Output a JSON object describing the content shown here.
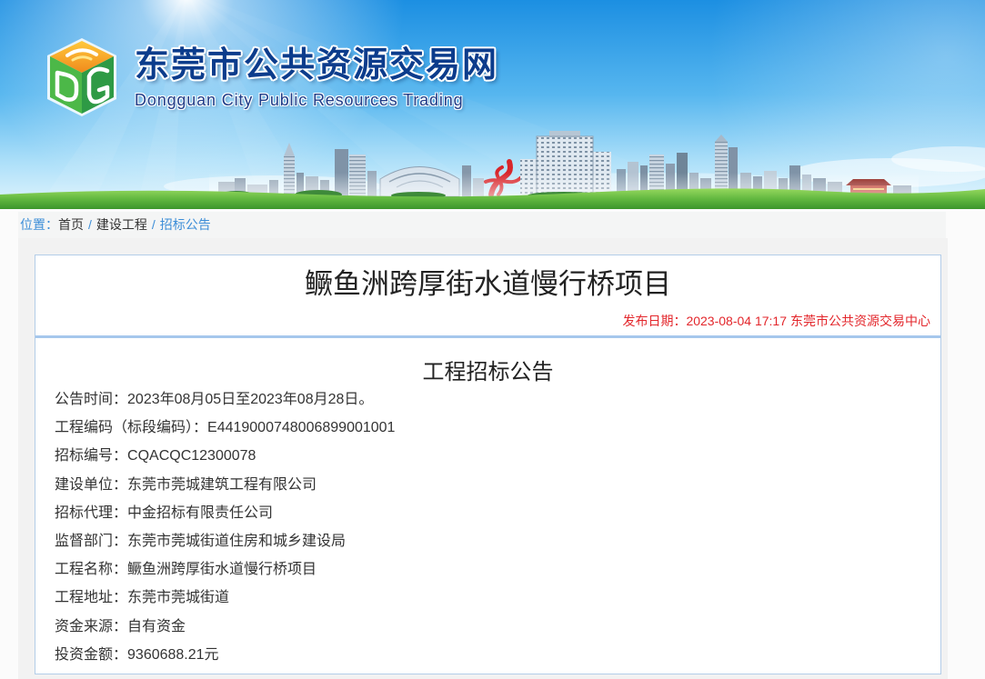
{
  "header": {
    "title_cn": "东莞市公共资源交易网",
    "title_en": "Dongguan City Public Resources Trading"
  },
  "breadcrumb": {
    "label": "位置：",
    "separator": "/",
    "items": [
      "首页",
      "建设工程",
      "招标公告"
    ]
  },
  "article": {
    "title": "鳜鱼洲跨厚街水道慢行桥项目",
    "publish_label": "发布日期：",
    "publish_date": "2023-08-04 17:17",
    "publisher": "东莞市公共资源交易中心",
    "heading": "工程招标公告",
    "fields": [
      {
        "label": "公告时间：",
        "value": "2023年08月05日至2023年08月28日。"
      },
      {
        "label": "工程编码（标段编码）：",
        "value": "E4419000748006899001001"
      },
      {
        "label": "招标编号：",
        "value": "CQACQC12300078"
      },
      {
        "label": "建设单位：",
        "value": "东莞市莞城建筑工程有限公司"
      },
      {
        "label": "招标代理：",
        "value": "中金招标有限责任公司"
      },
      {
        "label": "监督部门：",
        "value": "东莞市莞城街道住房和城乡建设局"
      },
      {
        "label": "工程名称：",
        "value": "鳜鱼洲跨厚街水道慢行桥项目"
      },
      {
        "label": "工程地址：",
        "value": "东莞市莞城街道"
      },
      {
        "label": "资金来源：",
        "value": "自有资金"
      },
      {
        "label": "投资金额：",
        "value": "9360688.21元"
      }
    ]
  },
  "colors": {
    "link_blue": "#3d8ed8",
    "publish_red": "#e3262b",
    "panel_border": "#b3cde8",
    "divider_blue": "#a6c7ec",
    "header_title": "#0c3c8c",
    "sky_blue": "#1c8fe2",
    "grass_green": "#4fae35"
  }
}
